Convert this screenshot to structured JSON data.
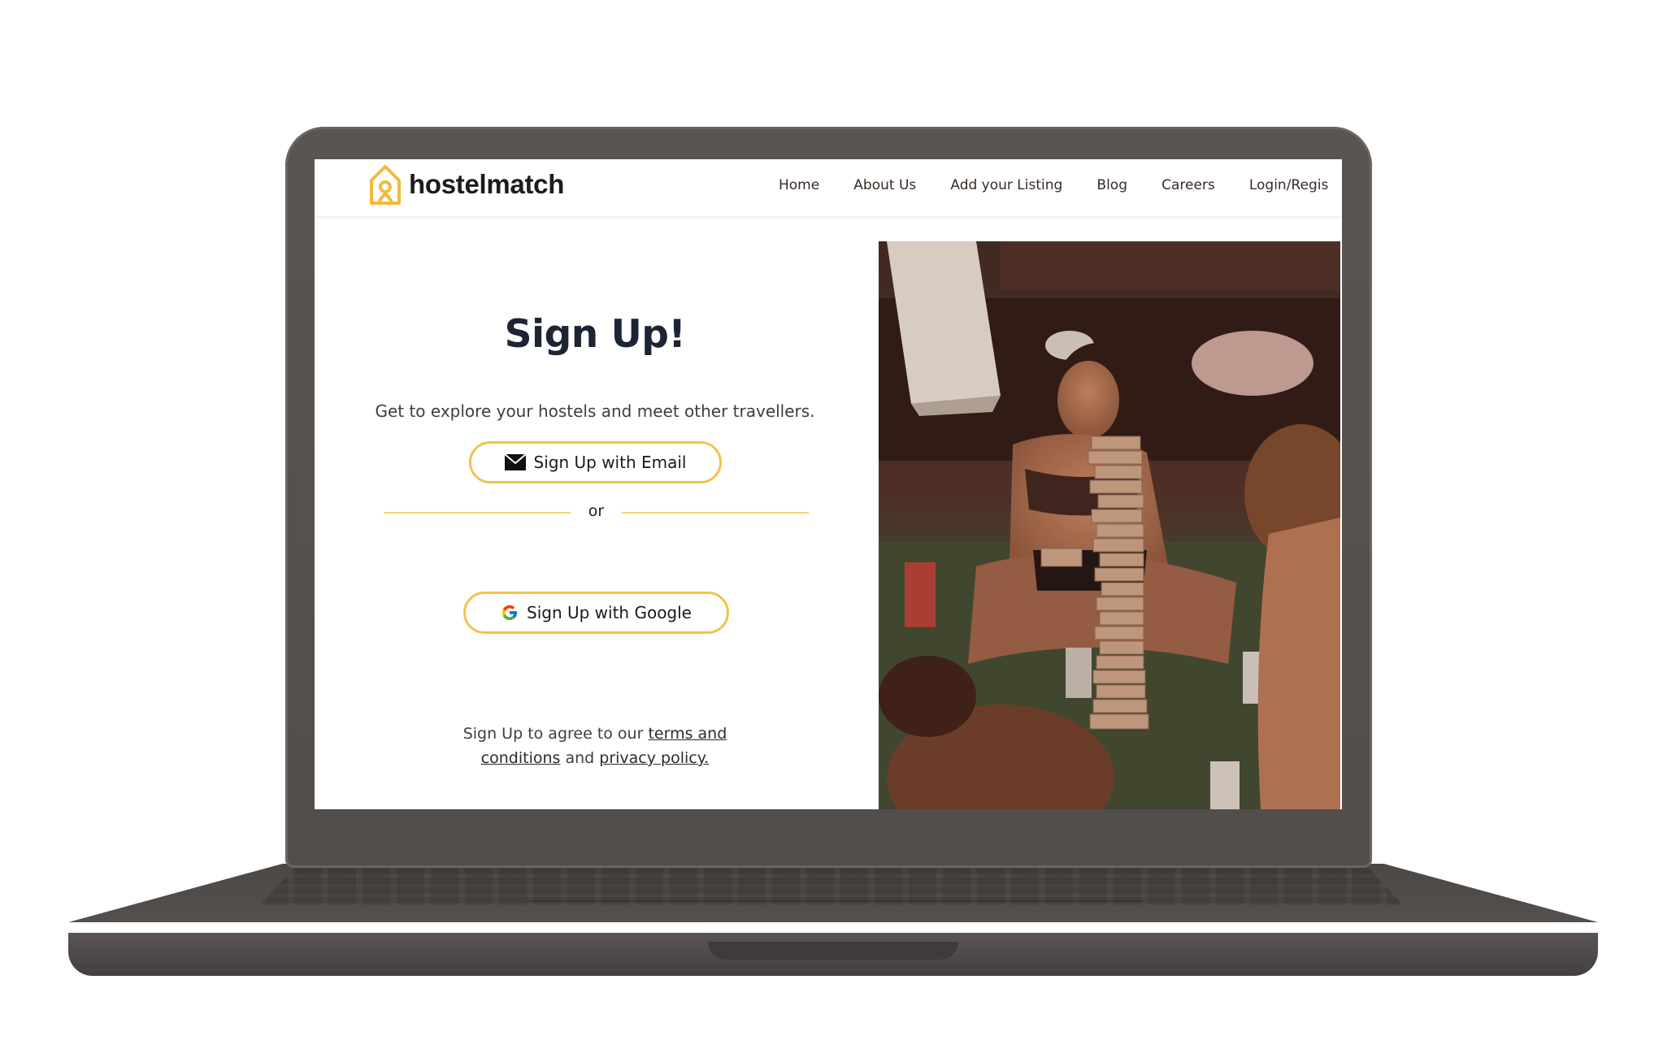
{
  "brand": {
    "name": "hostelmatch",
    "accent": "#f3c24a"
  },
  "nav": {
    "items": [
      "Home",
      "About Us",
      "Add your Listing",
      "Blog",
      "Careers",
      "Login/Regis"
    ]
  },
  "signup": {
    "title": "Sign Up!",
    "subtitle": "Get to explore your hostels and meet other travellers.",
    "email_button": {
      "label": "Sign Up with Email",
      "icon": "envelope-icon"
    },
    "divider_text": "or",
    "google_button": {
      "label": "Sign Up with Google",
      "icon": "google-icon"
    },
    "terms": {
      "prefix": "Sign Up to agree to our",
      "terms_link": "terms and conditions",
      "middle": "and",
      "privacy_link": "privacy policy."
    }
  },
  "device": {
    "frame_color": "#555050"
  }
}
